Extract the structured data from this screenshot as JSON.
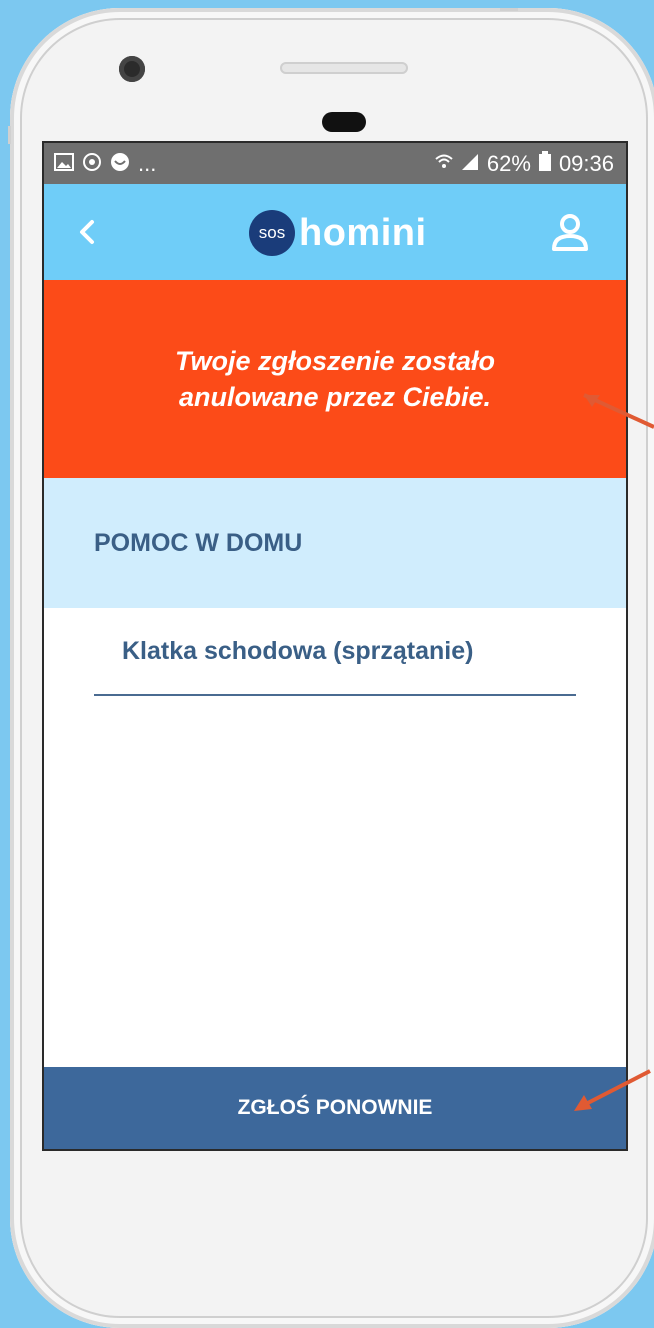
{
  "status_bar": {
    "left_icons": [
      "image-icon",
      "sync-icon",
      "smile-icon"
    ],
    "left_more": "...",
    "battery": "62%",
    "time": "09:36"
  },
  "app_bar": {
    "back_icon": "chevron-left-icon",
    "logo_badge": "sos",
    "logo_text": "homini",
    "profile_icon": "user-icon"
  },
  "banner": {
    "message": "Twoje zgłoszenie zostało anulowane przez Ciebie."
  },
  "category": {
    "title": "POMOC W DOMU"
  },
  "items": [
    {
      "label": "Klatka schodowa (sprzątanie)"
    }
  ],
  "footer": {
    "button_label": "ZGŁOŚ PONOWNIE"
  },
  "colors": {
    "background": "#7cc8f0",
    "app_bar": "#6fcdf8",
    "banner": "#fc4b18",
    "category": "#d0edfd",
    "button": "#3d689b",
    "text_dark_blue": "#3a5f86",
    "annotation_arrow": "#e05a33"
  }
}
